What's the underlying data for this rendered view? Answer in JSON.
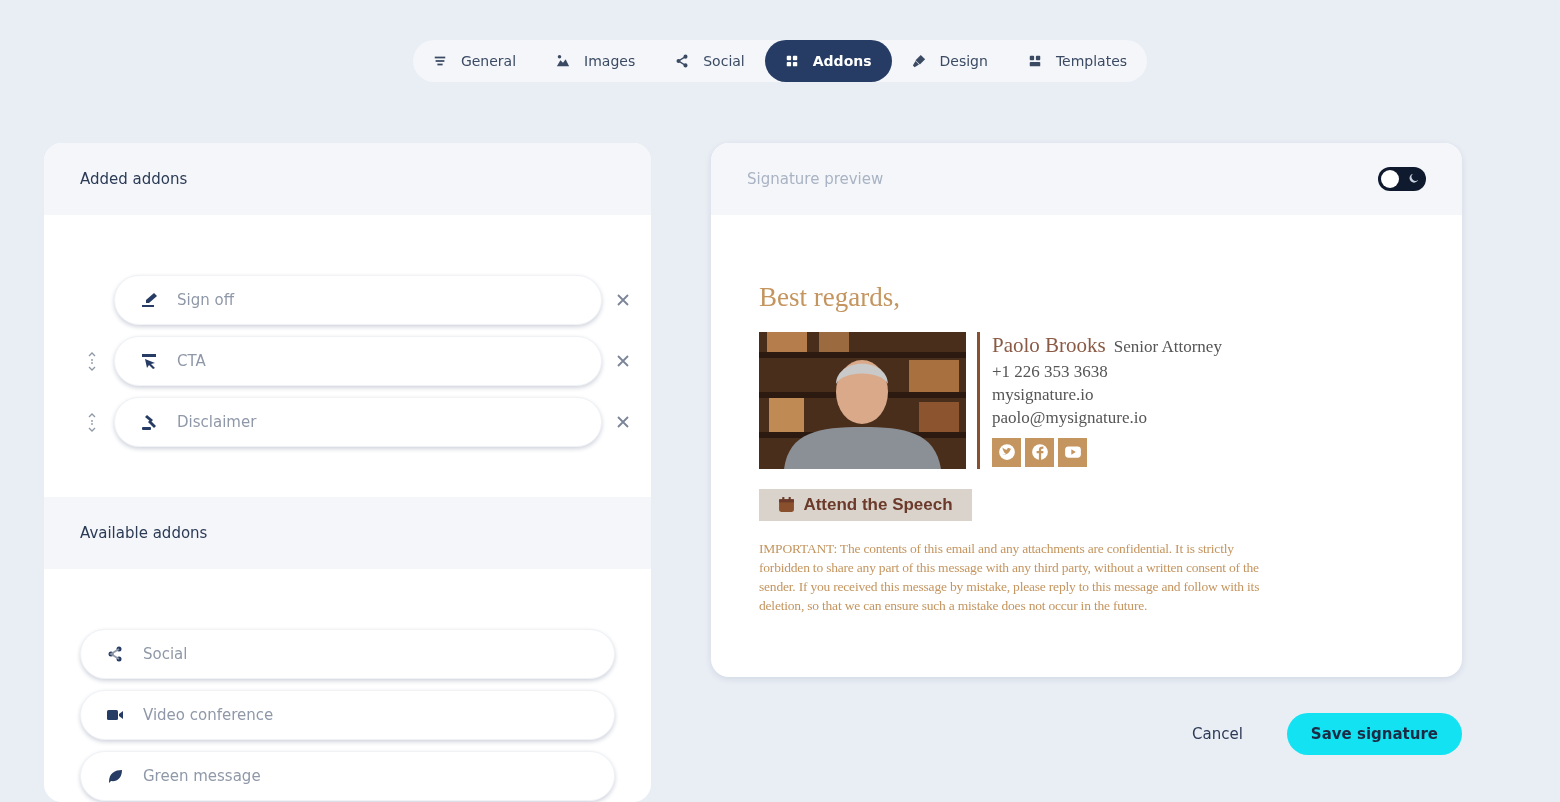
{
  "tabs": [
    {
      "label": "General",
      "selected": false
    },
    {
      "label": "Images",
      "selected": false
    },
    {
      "label": "Social",
      "selected": false
    },
    {
      "label": "Addons",
      "selected": true
    },
    {
      "label": "Design",
      "selected": false
    },
    {
      "label": "Templates",
      "selected": false
    }
  ],
  "added_addons": {
    "title": "Added addons",
    "items": [
      {
        "label": "Sign off",
        "movable": false
      },
      {
        "label": "CTA",
        "movable": true
      },
      {
        "label": "Disclaimer",
        "movable": true
      }
    ]
  },
  "available_addons": {
    "title": "Available addons",
    "items": [
      {
        "label": "Social"
      },
      {
        "label": "Video conference"
      },
      {
        "label": "Green message"
      }
    ]
  },
  "preview": {
    "title": "Signature preview",
    "dark_mode_toggle": {
      "on": false
    },
    "sign_off": "Best regards,",
    "name": "Paolo Brooks",
    "job_title": "Senior Attorney",
    "phone": "+1 226 353 3638",
    "website": "mysignature.io",
    "email": "paolo@mysignature.io",
    "social_links": [
      {
        "kind": "twitter"
      },
      {
        "kind": "facebook"
      },
      {
        "kind": "youtube"
      }
    ],
    "cta": "Attend the Speech",
    "disclaimer": "IMPORTANT: The contents of this email and any attachments are confidential. It is strictly forbidden to share any part of this message with any third party, without a written consent of the sender. If you received this message by mistake, please reply to this message and follow with its deletion, so that we can ensure such a mistake does not occur in the future."
  },
  "buttons": {
    "cancel": "Cancel",
    "save": "Save signature"
  }
}
